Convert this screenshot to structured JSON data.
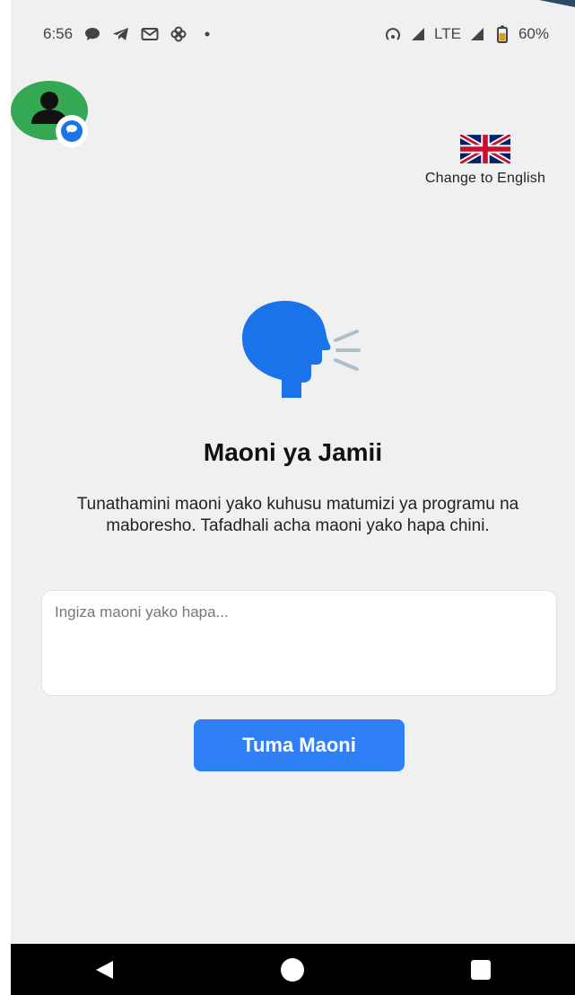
{
  "status_bar": {
    "time": "6:56",
    "network": "LTE",
    "battery": "60%",
    "left_icons": [
      "chat-bubble-icon",
      "telegram-icon",
      "gmail-icon",
      "pinwheel-icon",
      "dot-icon"
    ],
    "right_icons": [
      "hotspot-icon",
      "signal-icon",
      "signal-icon",
      "battery-icon"
    ]
  },
  "language": {
    "flag": "uk-flag-icon",
    "label": "Change to English"
  },
  "main": {
    "icon": "speaking-head-icon",
    "title": "Maoni ya Jamii",
    "description": "Tunathamini maoni yako kuhusu matumizi ya programu na maboresho. Tafadhali acha maoni yako hapa chini.",
    "input_placeholder": "Ingiza maoni yako hapa...",
    "input_value": "",
    "submit_label": "Tuma Maoni"
  },
  "colors": {
    "background": "#f0f0f0",
    "accent": "#2f80f6",
    "icon_blue": "#1a73e8",
    "chat_head_green": "#34a853"
  },
  "nav": {
    "buttons": [
      "back-icon",
      "home-icon",
      "recents-icon"
    ]
  }
}
